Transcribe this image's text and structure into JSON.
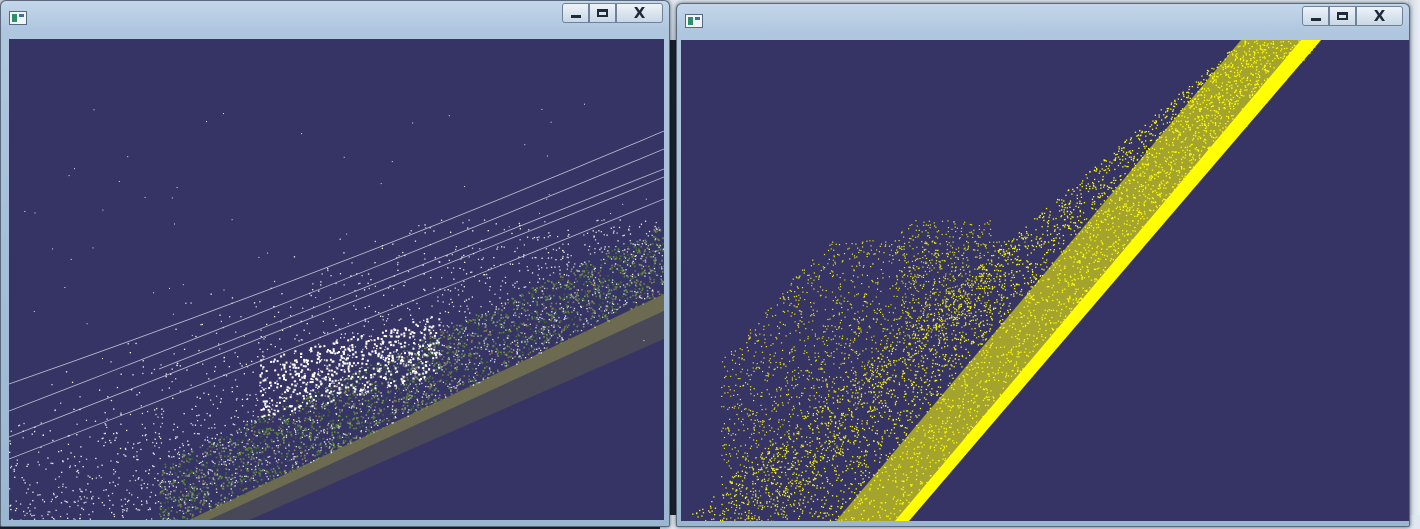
{
  "windows": [
    {
      "id": "left",
      "title": "",
      "view": "rgb-point-cloud",
      "icons": [
        "app-icon",
        "minimize-icon",
        "maximize-icon",
        "close-icon"
      ],
      "colors": {
        "background": "#363464",
        "foliage": "#4f7a3a",
        "points": "#ffffff"
      }
    },
    {
      "id": "right",
      "title": "",
      "view": "classified-point-cloud",
      "icons": [
        "app-icon",
        "minimize-icon",
        "maximize-icon",
        "close-icon"
      ],
      "colors": {
        "background": "#363464",
        "points": "#ffff00"
      }
    }
  ],
  "controls": {
    "close_glyph": "X"
  }
}
